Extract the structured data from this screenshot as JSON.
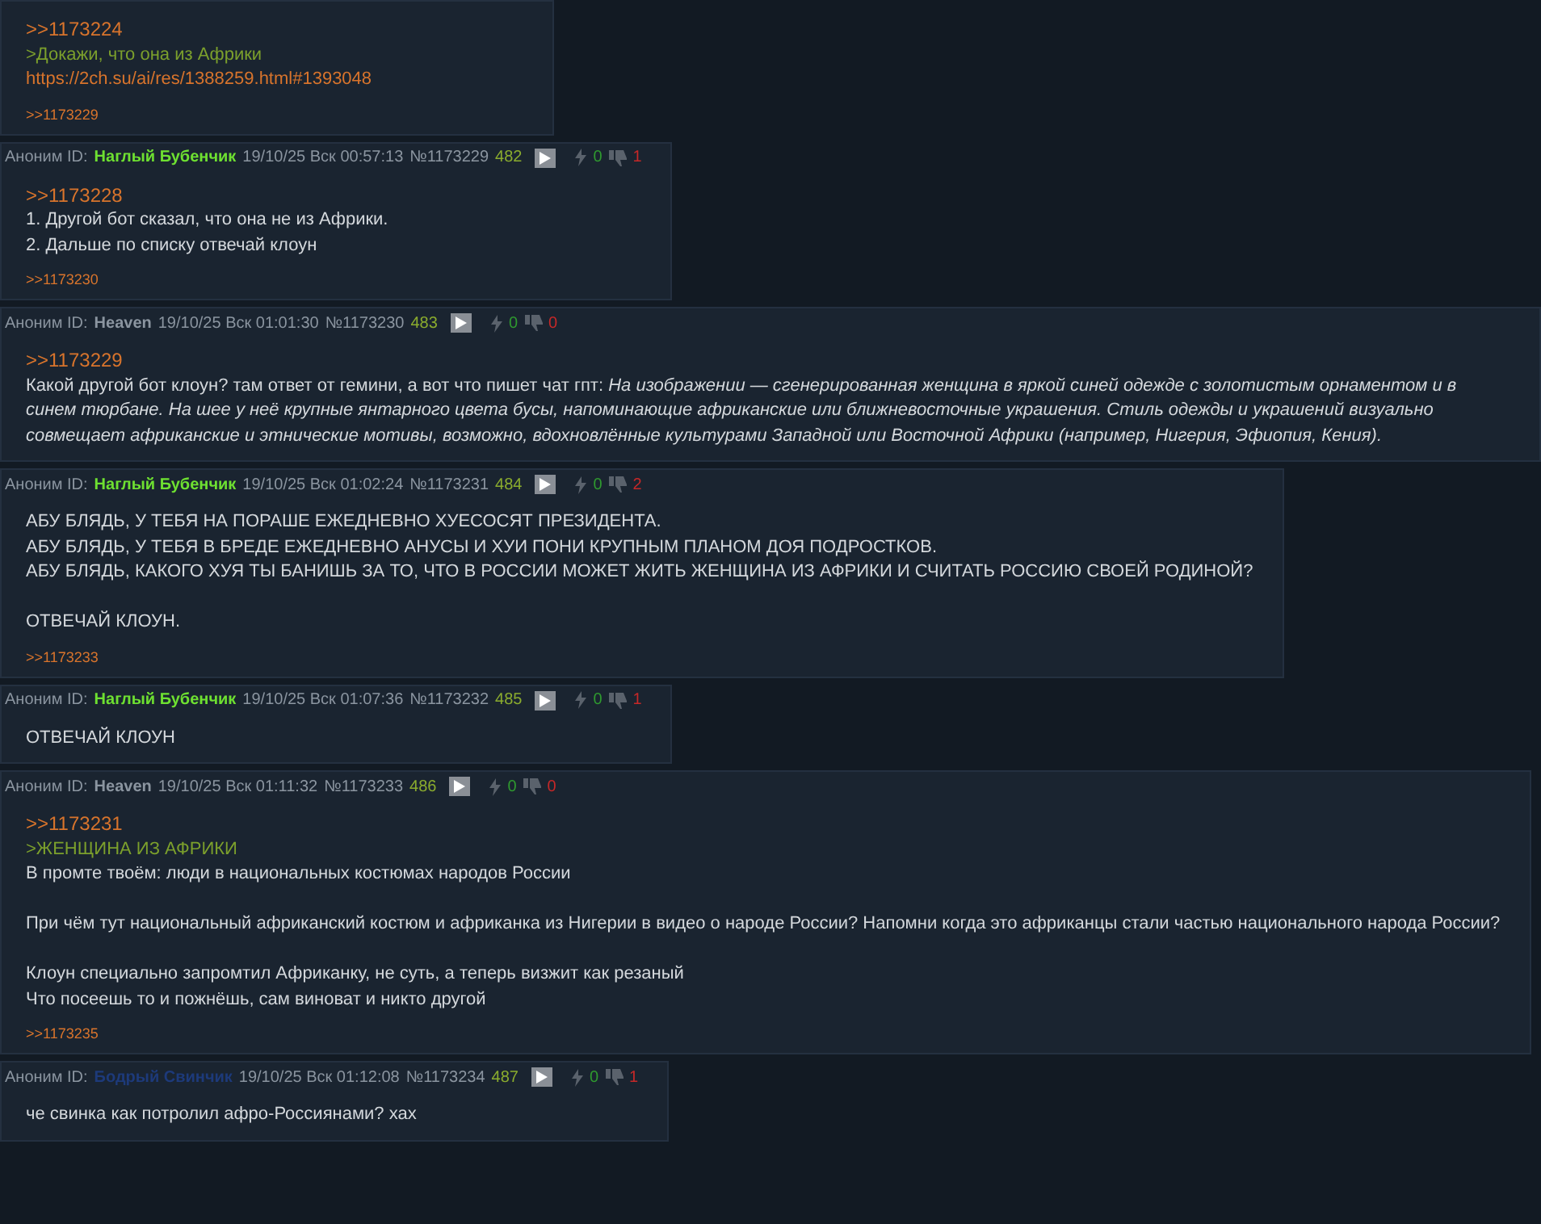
{
  "posts": [
    {
      "lines": [
        {
          "kind": "reply",
          "text": ">>1173224"
        },
        {
          "kind": "quote",
          "text": ">Докажи, что она из Африки"
        },
        {
          "kind": "link",
          "text": "https://2ch.su/ai/res/1388259.html#1393048"
        }
      ],
      "replies": [
        ">>1173229"
      ]
    },
    {
      "header": {
        "anon": "Аноним ID:",
        "name": "Наглый Бубенчик",
        "color": "#6ee031",
        "date": "19/10/25 Вск 00:57:13",
        "num": "№1173229",
        "count": "482",
        "likes": "0",
        "dislikes": "1"
      },
      "lines": [
        {
          "kind": "reply",
          "text": ">>1173228"
        },
        {
          "kind": "text",
          "text": "1. Другой бот сказал, что она не из Африки."
        },
        {
          "kind": "text",
          "text": "2. Дальше по списку отвечай клоун"
        }
      ],
      "replies": [
        ">>1173230"
      ]
    },
    {
      "header": {
        "anon": "Аноним ID:",
        "name": "Heaven",
        "color": "#8b95a0",
        "date": "19/10/25 Вск 01:01:30",
        "num": "№1173230",
        "count": "483",
        "likes": "0",
        "dislikes": "0"
      },
      "lines": [
        {
          "kind": "reply",
          "text": ">>1173229"
        },
        {
          "kind": "text",
          "text": "Какой другой бот клоун? там ответ от гемини, а вот что пишет чат гпт: *На изображении — сгенерированная женщина в яркой синей одежде с золотистым орнаментом и в синем тюрбане. На шее у неё крупные янтарного цвета бусы, напоминающие африканские или ближневосточные украшения. Стиль одежды и украшений визуально совмещает африканские и этнические мотивы, возможно, вдохновлённые культурами Западной или Восточной Африки (например, Нигерия, Эфиопия, Кения).*"
        }
      ]
    },
    {
      "header": {
        "anon": "Аноним ID:",
        "name": "Наглый Бубенчик",
        "color": "#6ee031",
        "date": "19/10/25 Вск 01:02:24",
        "num": "№1173231",
        "count": "484",
        "likes": "0",
        "dislikes": "2"
      },
      "lines": [
        {
          "kind": "text",
          "text": "АБУ БЛЯДЬ, У ТЕБЯ НА ПОРАШЕ ЕЖЕДНЕВНО ХУЕСОСЯТ ПРЕЗИДЕНТА."
        },
        {
          "kind": "text",
          "text": "АБУ БЛЯДЬ, У ТЕБЯ В БРЕДЕ ЕЖЕДНЕВНО АНУСЫ И ХУИ ПОНИ КРУПНЫМ ПЛАНОМ ДОЯ ПОДРОСТКОВ."
        },
        {
          "kind": "text",
          "text": "АБУ БЛЯДЬ, КАКОГО ХУЯ ТЫ БАНИШЬ ЗА ТО, ЧТО В РОССИИ МОЖЕТ ЖИТЬ ЖЕНЩИНА ИЗ АФРИКИ И СЧИТАТЬ РОССИЮ СВОЕЙ РОДИНОЙ?"
        },
        {
          "kind": "gap"
        },
        {
          "kind": "text",
          "text": "ОТВЕЧАЙ КЛОУН."
        }
      ],
      "replies": [
        ">>1173233"
      ]
    },
    {
      "header": {
        "anon": "Аноним ID:",
        "name": "Наглый Бубенчик",
        "color": "#6ee031",
        "date": "19/10/25 Вск 01:07:36",
        "num": "№1173232",
        "count": "485",
        "likes": "0",
        "dislikes": "1"
      },
      "lines": [
        {
          "kind": "text",
          "text": "ОТВЕЧАЙ КЛОУН"
        }
      ]
    },
    {
      "header": {
        "anon": "Аноним ID:",
        "name": "Heaven",
        "color": "#8b95a0",
        "date": "19/10/25 Вск 01:11:32",
        "num": "№1173233",
        "count": "486",
        "likes": "0",
        "dislikes": "0"
      },
      "lines": [
        {
          "kind": "reply",
          "text": ">>1173231"
        },
        {
          "kind": "quote",
          "text": ">ЖЕНЩИНА ИЗ АФРИКИ"
        },
        {
          "kind": "text",
          "text": "В промте твоём: люди в национальных костюмах народов России"
        },
        {
          "kind": "gap"
        },
        {
          "kind": "text",
          "text": "При чём тут национальный африканский костюм и африканка из Нигерии в видео о народе России? Напомни когда это африканцы стали частью национального народа России?"
        },
        {
          "kind": "gap"
        },
        {
          "kind": "text",
          "text": "Клоун специально запромтил Африканку, не суть, а теперь визжит как резаный"
        },
        {
          "kind": "text",
          "text": "Что посеешь то и пожнёшь, сам виноват и никто другой"
        }
      ],
      "replies": [
        ">>1173235"
      ]
    },
    {
      "header": {
        "anon": "Аноним ID:",
        "name": "Бодрый Свинчик",
        "color": "#1d3a7a",
        "date": "19/10/25 Вск 01:12:08",
        "num": "№1173234",
        "count": "487",
        "likes": "0",
        "dislikes": "1"
      },
      "lines": [
        {
          "kind": "text",
          "text": "че свинка как потролил афро-Россиянами? хах"
        }
      ]
    }
  ]
}
